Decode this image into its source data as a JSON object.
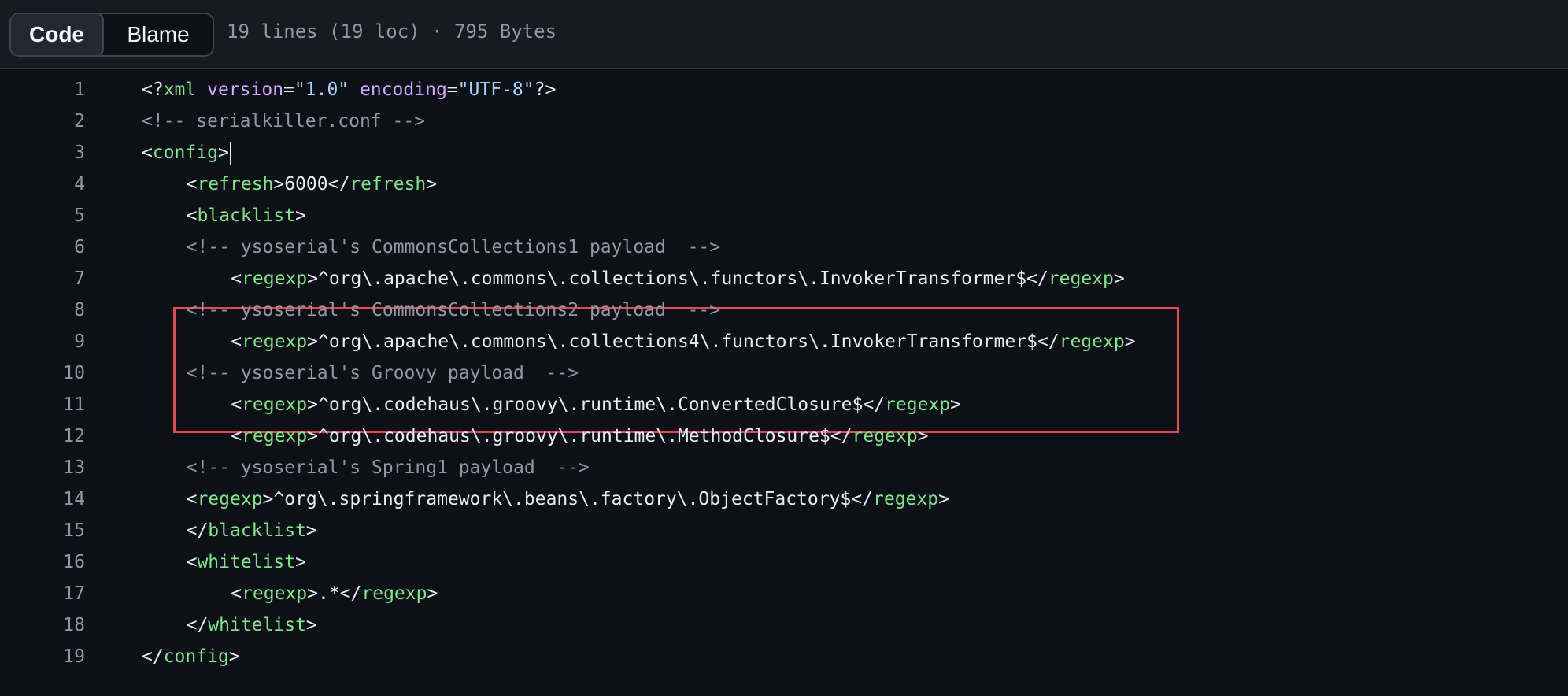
{
  "toolbar": {
    "code_label": "Code",
    "blame_label": "Blame",
    "file_info": "19 lines (19 loc) · 795 Bytes"
  },
  "colors": {
    "tag": "#7ee787",
    "attribute": "#d2a8ff",
    "string": "#a5d6ff",
    "comment": "#9198a1",
    "highlight_border": "#e5484d"
  },
  "code": {
    "lines": [
      {
        "n": "1",
        "indent": 0,
        "tokens": [
          [
            "t",
            "<?"
          ],
          [
            "tag",
            "xml"
          ],
          [
            "t",
            " "
          ],
          [
            "attr",
            "version"
          ],
          [
            "t",
            "="
          ],
          [
            "str",
            "\"1.0\""
          ],
          [
            "t",
            " "
          ],
          [
            "attr",
            "encoding"
          ],
          [
            "t",
            "="
          ],
          [
            "str",
            "\"UTF-8\""
          ],
          [
            "t",
            "?>"
          ]
        ]
      },
      {
        "n": "2",
        "indent": 0,
        "tokens": [
          [
            "com",
            "<!-- serialkiller.conf -->"
          ]
        ]
      },
      {
        "n": "3",
        "indent": 0,
        "caret": true,
        "tokens": [
          [
            "t",
            "<"
          ],
          [
            "tag",
            "config"
          ],
          [
            "t",
            ">"
          ]
        ]
      },
      {
        "n": "4",
        "indent": 4,
        "tokens": [
          [
            "t",
            "<"
          ],
          [
            "tag",
            "refresh"
          ],
          [
            "t",
            ">6000</"
          ],
          [
            "tag",
            "refresh"
          ],
          [
            "t",
            ">"
          ]
        ]
      },
      {
        "n": "5",
        "indent": 4,
        "tokens": [
          [
            "t",
            "<"
          ],
          [
            "tag",
            "blacklist"
          ],
          [
            "t",
            ">"
          ]
        ]
      },
      {
        "n": "6",
        "indent": 4,
        "tokens": [
          [
            "com",
            "<!-- ysoserial's CommonsCollections1 payload  -->"
          ]
        ]
      },
      {
        "n": "7",
        "indent": 8,
        "tokens": [
          [
            "t",
            "<"
          ],
          [
            "tag",
            "regexp"
          ],
          [
            "t",
            ">^org\\.apache\\.commons\\.collections\\.functors\\.InvokerTransformer$</"
          ],
          [
            "tag",
            "regexp"
          ],
          [
            "t",
            ">"
          ]
        ]
      },
      {
        "n": "8",
        "indent": 4,
        "tokens": [
          [
            "com",
            "<!-- ysoserial's CommonsCollections2 payload  -->"
          ]
        ]
      },
      {
        "n": "9",
        "indent": 8,
        "tokens": [
          [
            "t",
            "<"
          ],
          [
            "tag",
            "regexp"
          ],
          [
            "t",
            ">^org\\.apache\\.commons\\.collections4\\.functors\\.InvokerTransformer$</"
          ],
          [
            "tag",
            "regexp"
          ],
          [
            "t",
            ">"
          ]
        ]
      },
      {
        "n": "10",
        "indent": 4,
        "tokens": [
          [
            "com",
            "<!-- ysoserial's Groovy payload  -->"
          ]
        ]
      },
      {
        "n": "11",
        "indent": 8,
        "tokens": [
          [
            "t",
            "<"
          ],
          [
            "tag",
            "regexp"
          ],
          [
            "t",
            ">^org\\.codehaus\\.groovy\\.runtime\\.ConvertedClosure$</"
          ],
          [
            "tag",
            "regexp"
          ],
          [
            "t",
            ">"
          ]
        ]
      },
      {
        "n": "12",
        "indent": 8,
        "tokens": [
          [
            "t",
            "<"
          ],
          [
            "tag",
            "regexp"
          ],
          [
            "t",
            ">^org\\.codehaus\\.groovy\\.runtime\\.MethodClosure$</"
          ],
          [
            "tag",
            "regexp"
          ],
          [
            "t",
            ">"
          ]
        ]
      },
      {
        "n": "13",
        "indent": 4,
        "tokens": [
          [
            "com",
            "<!-- ysoserial's Spring1 payload  -->"
          ]
        ]
      },
      {
        "n": "14",
        "indent": 4,
        "tokens": [
          [
            "t",
            "<"
          ],
          [
            "tag",
            "regexp"
          ],
          [
            "t",
            ">^org\\.springframework\\.beans\\.factory\\.ObjectFactory$</"
          ],
          [
            "tag",
            "regexp"
          ],
          [
            "t",
            ">"
          ]
        ]
      },
      {
        "n": "15",
        "indent": 4,
        "tokens": [
          [
            "t",
            "</"
          ],
          [
            "tag",
            "blacklist"
          ],
          [
            "t",
            ">"
          ]
        ]
      },
      {
        "n": "16",
        "indent": 4,
        "tokens": [
          [
            "t",
            "<"
          ],
          [
            "tag",
            "whitelist"
          ],
          [
            "t",
            ">"
          ]
        ]
      },
      {
        "n": "17",
        "indent": 8,
        "tokens": [
          [
            "t",
            "<"
          ],
          [
            "tag",
            "regexp"
          ],
          [
            "t",
            ">.*</"
          ],
          [
            "tag",
            "regexp"
          ],
          [
            "t",
            ">"
          ]
        ]
      },
      {
        "n": "18",
        "indent": 4,
        "tokens": [
          [
            "t",
            "</"
          ],
          [
            "tag",
            "whitelist"
          ],
          [
            "t",
            ">"
          ]
        ]
      },
      {
        "n": "19",
        "indent": 0,
        "tokens": [
          [
            "t",
            "</"
          ],
          [
            "tag",
            "config"
          ],
          [
            "t",
            ">"
          ]
        ]
      }
    ]
  }
}
